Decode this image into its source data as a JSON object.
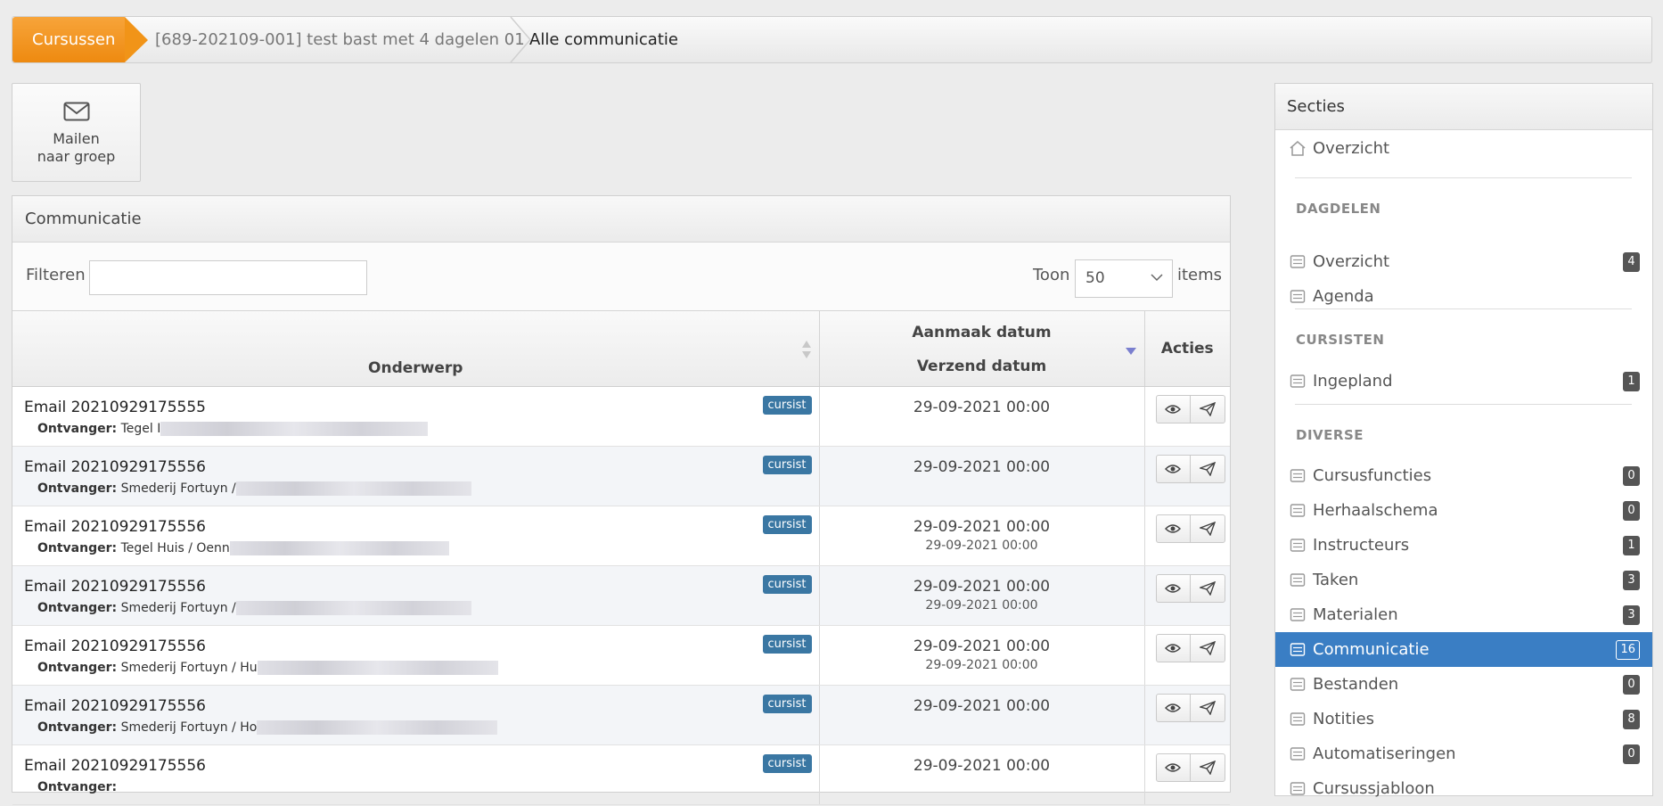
{
  "breadcrumb": {
    "home": "Cursussen",
    "course": "[689-202109-001] test bast met 4 dagelen 01",
    "current": "Alle communicatie"
  },
  "mail_button": {
    "line1": "Mailen",
    "line2": "naar groep",
    "icon": "envelope-icon"
  },
  "panel": {
    "title": "Communicatie",
    "filter_label": "Filteren",
    "filter_value": "",
    "toon_label": "Toon",
    "toon_value": "50",
    "items_label": "items"
  },
  "table": {
    "col_subject": "Onderwerp",
    "col_date_top": "Aanmaak datum",
    "col_date_bottom": "Verzend datum",
    "col_actions": "Acties",
    "recipient_label": "Ontvanger:",
    "rows": [
      {
        "subject": "Email 20210929175555",
        "badge": "cursist",
        "recipient": "Tegel I",
        "created": "29-09-2021 00:00",
        "sent": ""
      },
      {
        "subject": "Email 20210929175556",
        "badge": "cursist",
        "recipient": "Smederij Fortuyn /",
        "created": "29-09-2021 00:00",
        "sent": ""
      },
      {
        "subject": "Email 20210929175556",
        "badge": "cursist",
        "recipient": "Tegel Huis / Oenn",
        "created": "29-09-2021 00:00",
        "sent": "29-09-2021 00:00"
      },
      {
        "subject": "Email 20210929175556",
        "badge": "cursist",
        "recipient": "Smederij Fortuyn /",
        "created": "29-09-2021 00:00",
        "sent": "29-09-2021 00:00"
      },
      {
        "subject": "Email 20210929175556",
        "badge": "cursist",
        "recipient": "Smederij Fortuyn / Hu",
        "created": "29-09-2021 00:00",
        "sent": "29-09-2021 00:00"
      },
      {
        "subject": "Email 20210929175556",
        "badge": "cursist",
        "recipient": "Smederij Fortuyn / Ho",
        "created": "29-09-2021 00:00",
        "sent": ""
      },
      {
        "subject": "Email 20210929175556",
        "badge": "cursist",
        "recipient": "",
        "created": "29-09-2021 00:00",
        "sent": ""
      }
    ]
  },
  "sidebar": {
    "title": "Secties",
    "overview": "Overzicht",
    "group_dagdelen": "DAGDELEN",
    "group_cursisten": "CURSISTEN",
    "group_diverse": "DIVERSE",
    "items": [
      {
        "label": "Overzicht",
        "count": "4"
      },
      {
        "label": "Agenda",
        "count": ""
      },
      {
        "label": "Ingepland",
        "count": "1"
      },
      {
        "label": "Cursusfuncties",
        "count": "0"
      },
      {
        "label": "Herhaalschema",
        "count": "0"
      },
      {
        "label": "Instructeurs",
        "count": "1"
      },
      {
        "label": "Taken",
        "count": "3"
      },
      {
        "label": "Materialen",
        "count": "3"
      },
      {
        "label": "Communicatie",
        "count": "16"
      },
      {
        "label": "Bestanden",
        "count": "0"
      },
      {
        "label": "Notities",
        "count": "8"
      },
      {
        "label": "Automatiseringen",
        "count": "0"
      },
      {
        "label": "Cursussjabloon",
        "count": ""
      }
    ]
  },
  "colors": {
    "accent_orange": "#f19418",
    "active_blue": "#3a7ec4",
    "badge_blue": "#3a77a3"
  }
}
